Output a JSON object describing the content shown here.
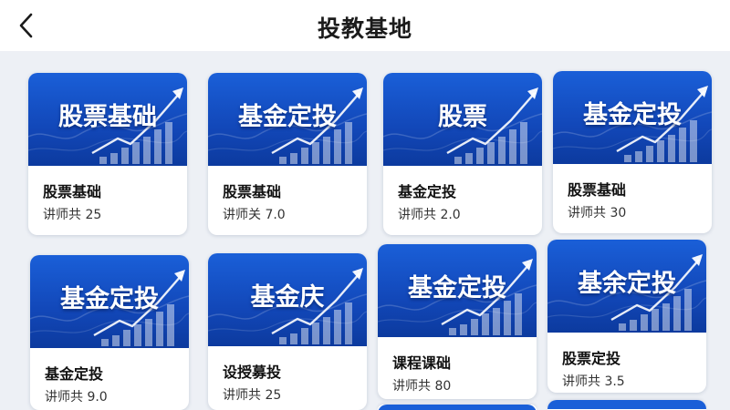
{
  "header": {
    "title": "投教基地"
  },
  "courses": [
    {
      "banner": "股票基础",
      "title": "股票基础",
      "subtitle": "讲师共 25"
    },
    {
      "banner": "基金定投",
      "title": "股票基础",
      "subtitle": "讲师关 7.0"
    },
    {
      "banner": "股票",
      "title": "基金定投",
      "subtitle": "讲师共 2.0"
    },
    {
      "banner": "基金定投",
      "title": "股票基础",
      "subtitle": "讲师共 30"
    },
    {
      "banner": "基金定投",
      "title": "基金定投",
      "subtitle": "讲师共 9.0"
    },
    {
      "banner": "基金庆",
      "title": "设授募投",
      "subtitle": "讲师共 25"
    },
    {
      "banner": "基金定投",
      "title": "课程课础",
      "subtitle": "讲师共 80"
    },
    {
      "banner": "基余定投",
      "title": "股票定投",
      "subtitle": "讲师共 3.5"
    }
  ],
  "colors": {
    "banner_blue": "#1a5fd8",
    "banner_dark": "#0c3a9e",
    "page_bg": "#edf0f5"
  }
}
